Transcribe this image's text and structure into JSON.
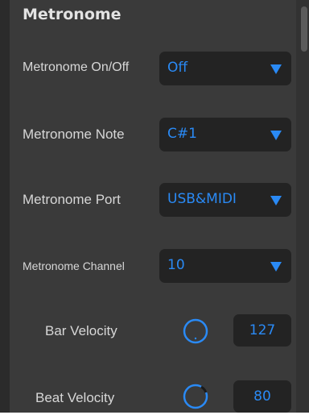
{
  "section": {
    "title": "Metronome"
  },
  "settings": [
    {
      "label": "Metronome On/Off",
      "value": "Off",
      "icon": "dropdown-arrow-icon"
    },
    {
      "label": "Metronome Note",
      "value": "C#1",
      "icon": "dropdown-arrow-icon"
    },
    {
      "label": "Metronome Port",
      "value": "USB&MIDI",
      "icon": "dropdown-arrow-icon"
    },
    {
      "label": "Metronome Channel",
      "value": "10",
      "icon": "dropdown-arrow-icon"
    }
  ],
  "velocities": [
    {
      "label": "Bar Velocity",
      "value": "127",
      "level": 1.0,
      "icon": "knob-icon"
    },
    {
      "label": "Beat Velocity",
      "value": "80",
      "level": 0.63,
      "icon": "knob-icon"
    }
  ],
  "colors": {
    "accent": "#2a8af5",
    "panel": "#3a3a3a",
    "field": "#232323",
    "label": "#d7d7d7"
  }
}
